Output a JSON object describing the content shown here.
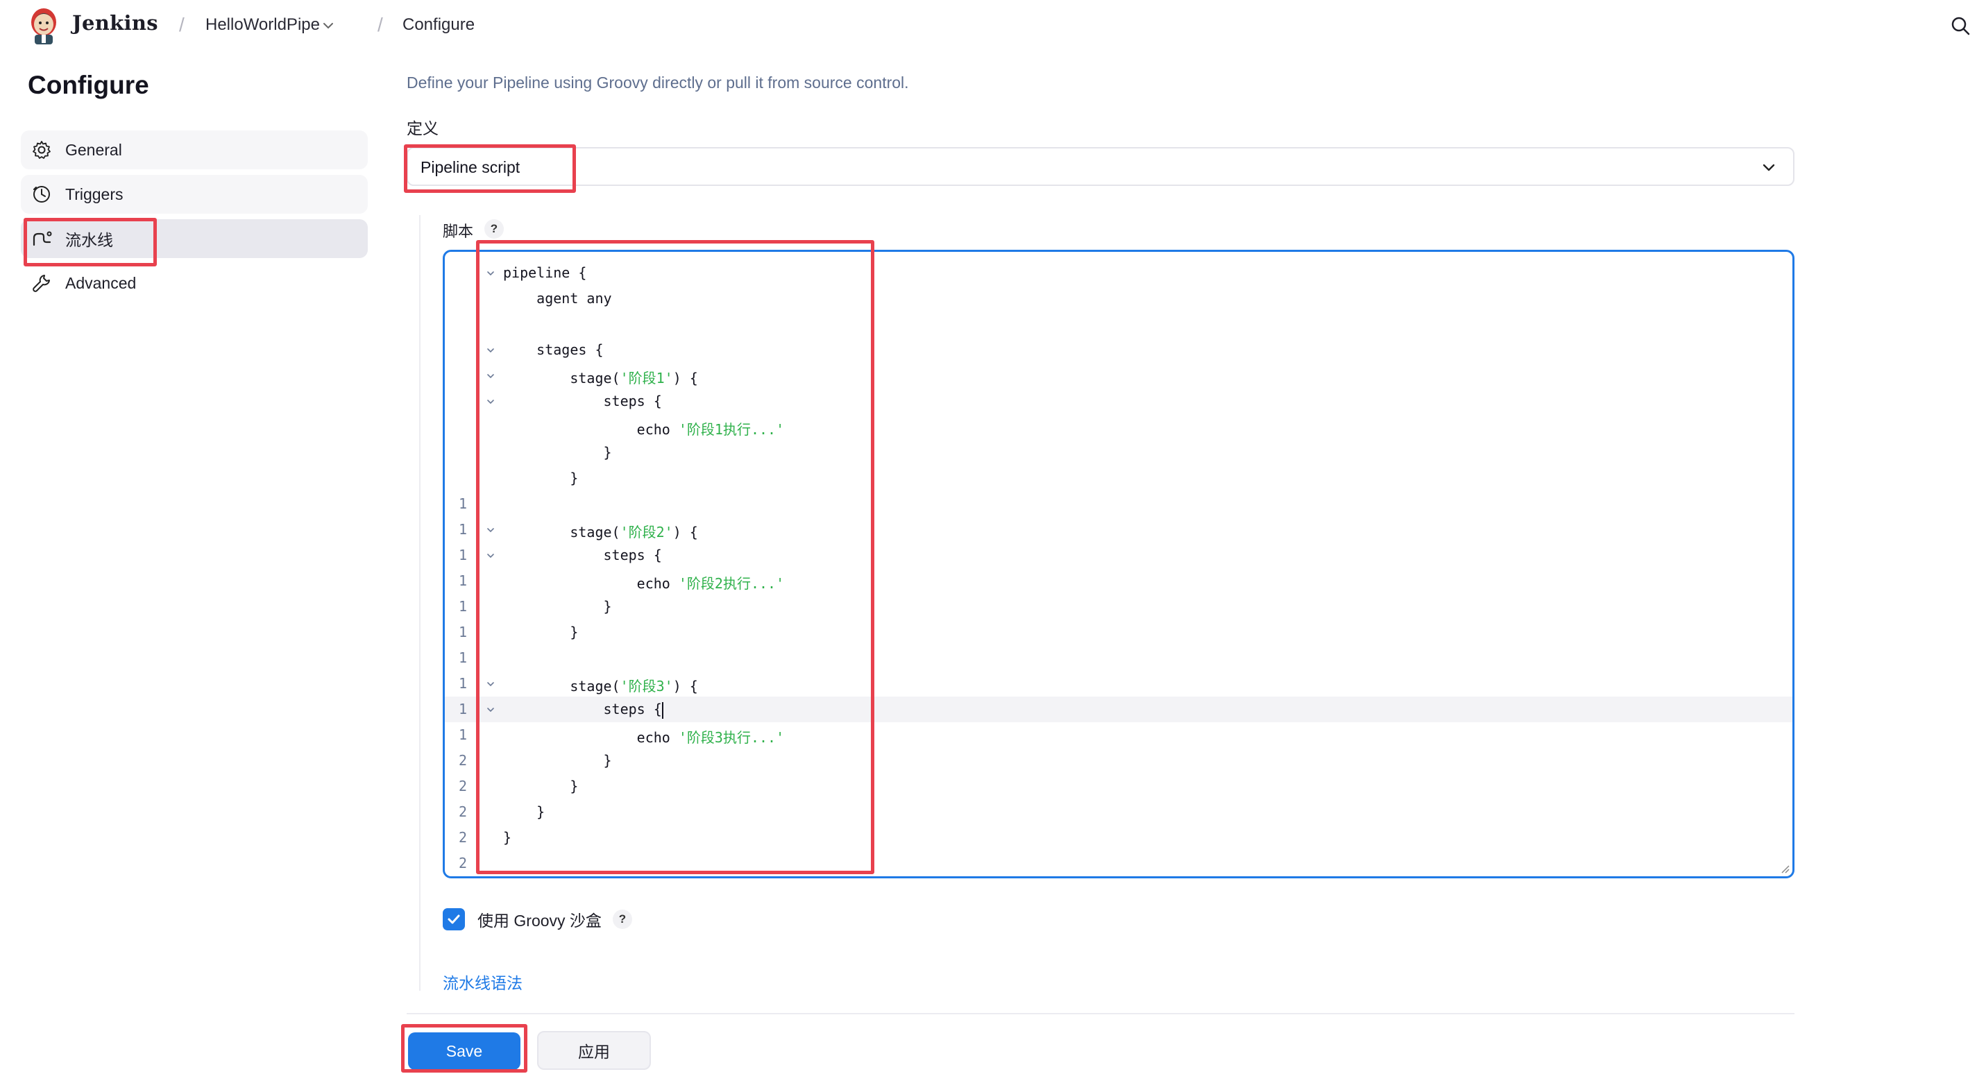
{
  "header": {
    "brand": "Jenkins",
    "breadcrumb": [
      "HelloWorldPipe",
      "Configure"
    ],
    "icons": [
      "jenkins-logo-icon",
      "chevron-down-icon",
      "search-icon"
    ]
  },
  "sidebar": {
    "title": "Configure",
    "items": [
      {
        "label": "General",
        "icon": "gear-icon"
      },
      {
        "label": "Triggers",
        "icon": "clock-icon"
      },
      {
        "label": "流水线",
        "icon": "pipeline-icon",
        "active": true
      },
      {
        "label": "Advanced",
        "icon": "wrench-icon"
      }
    ]
  },
  "main": {
    "description": "Define your Pipeline using Groovy directly or pull it from source control.",
    "definition_label": "定义",
    "definition_value": "Pipeline script",
    "script_label": "脚本",
    "help_glyph": "?",
    "code_lines": [
      {
        "num": "",
        "fold": true,
        "code": "pipeline {"
      },
      {
        "num": "",
        "fold": false,
        "code": "    agent any"
      },
      {
        "num": "",
        "fold": false,
        "code": ""
      },
      {
        "num": "",
        "fold": true,
        "code": "    stages {"
      },
      {
        "num": "",
        "fold": true,
        "code": "        stage(",
        "str": "'阶段1'",
        "rest": ") {"
      },
      {
        "num": "",
        "fold": true,
        "code": "            steps {"
      },
      {
        "num": "",
        "fold": false,
        "code": "                echo ",
        "str": "'阶段1执行...'"
      },
      {
        "num": "",
        "fold": false,
        "code": "            }"
      },
      {
        "num": "",
        "fold": false,
        "code": "        }"
      },
      {
        "num": "1",
        "fold": false,
        "code": ""
      },
      {
        "num": "1",
        "fold": true,
        "code": "        stage(",
        "str": "'阶段2'",
        "rest": ") {"
      },
      {
        "num": "1",
        "fold": true,
        "code": "            steps {"
      },
      {
        "num": "1",
        "fold": false,
        "code": "                echo ",
        "str": "'阶段2执行...'"
      },
      {
        "num": "1",
        "fold": false,
        "code": "            }"
      },
      {
        "num": "1",
        "fold": false,
        "code": "        }"
      },
      {
        "num": "1",
        "fold": false,
        "code": ""
      },
      {
        "num": "1",
        "fold": true,
        "code": "        stage(",
        "str": "'阶段3'",
        "rest": ") {"
      },
      {
        "num": "1",
        "fold": true,
        "code": "            steps {",
        "caret": true,
        "active": true
      },
      {
        "num": "1",
        "fold": false,
        "code": "                echo ",
        "str": "'阶段3执行...'"
      },
      {
        "num": "2",
        "fold": false,
        "code": "            }"
      },
      {
        "num": "2",
        "fold": false,
        "code": "        }"
      },
      {
        "num": "2",
        "fold": false,
        "code": "    }"
      },
      {
        "num": "2",
        "fold": false,
        "code": "}"
      },
      {
        "num": "2",
        "fold": false,
        "code": ""
      }
    ],
    "sandbox_label": "使用 Groovy 沙盒",
    "sandbox_checked": true,
    "syntax_link": "流水线语法",
    "save_label": "Save",
    "apply_label": "应用"
  },
  "colors": {
    "accent": "#1f7ae6",
    "annotation_red": "#e8414e",
    "string_green": "#2fb14b"
  }
}
